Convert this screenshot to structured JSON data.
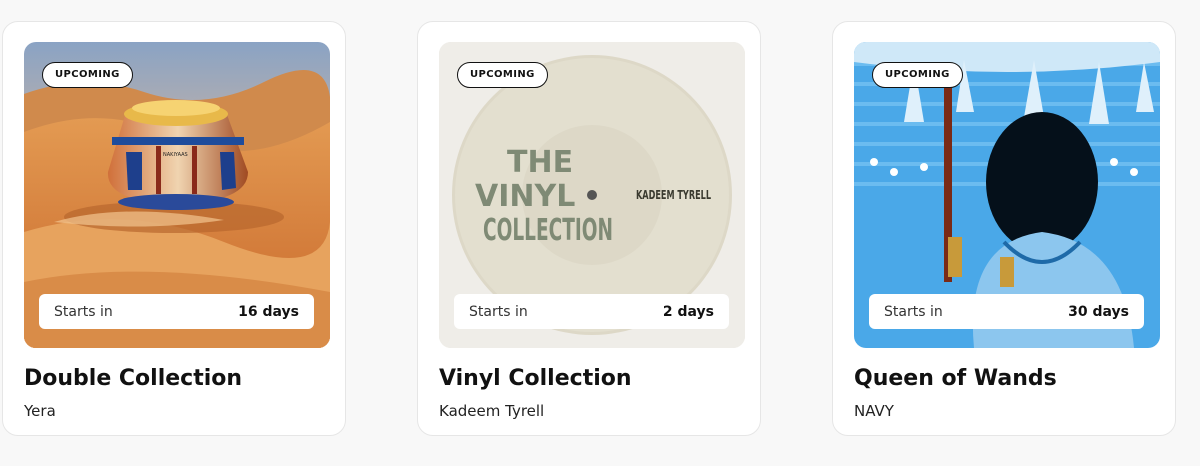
{
  "cards": [
    {
      "badge": "UPCOMING",
      "timer_label": "Starts in",
      "timer_value": "16 days",
      "title": "Double Collection",
      "creator": "Yera",
      "image_artwork_text": "NAKIYAAS"
    },
    {
      "badge": "UPCOMING",
      "timer_label": "Starts in",
      "timer_value": "2 days",
      "title": "Vinyl Collection",
      "creator": "Kadeem Tyrell",
      "record_title_lines": [
        "THE",
        "VINYL",
        "COLLECTION"
      ],
      "record_artist": "KADEEM TYRELL"
    },
    {
      "badge": "UPCOMING",
      "timer_label": "Starts in",
      "timer_value": "30 days",
      "title": "Queen of Wands",
      "creator": "NAVY"
    }
  ],
  "colors": {
    "page_background": "#f8f8f8",
    "card_background": "#ffffff",
    "text_primary": "#111111"
  }
}
